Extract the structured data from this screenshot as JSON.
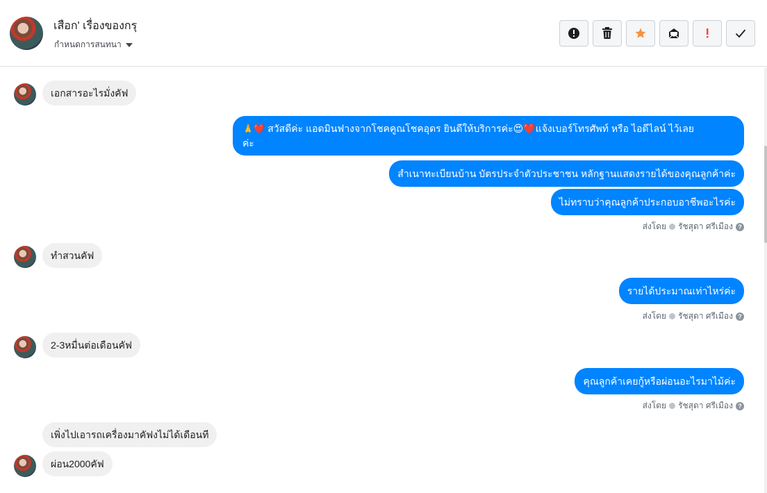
{
  "header": {
    "contact_name": "เสือก' เรื่องของกรุ",
    "assign_label": "กำหนดการสนทนา",
    "actions": [
      {
        "name": "spam",
        "icon": "exclamation-circle-icon"
      },
      {
        "name": "delete",
        "icon": "trash-icon"
      },
      {
        "name": "star",
        "icon": "star-icon",
        "color": "#f7923b"
      },
      {
        "name": "mark-unread",
        "icon": "envelope-icon"
      },
      {
        "name": "important",
        "icon": "exclamation-icon",
        "color": "#fa3e3e"
      },
      {
        "name": "done",
        "icon": "check-icon"
      }
    ]
  },
  "messages": {
    "m1": "เอกสารอะไรมั่งคัฟ",
    "m2_icons": "🙏❤️",
    "m2_line1": "สวัสดีค่ะ แอดมินฟางจากโชคคูณโชคอุดร ยินดีให้บริการค่ะ😍❤️แจ้งเบอร์โทรศัพท์ หรือ ไอดีไลน์  ไว้เลย",
    "m2_line2": "ค่ะ",
    "m3": "สำเนาทะเบียนบ้าน บัตรประจำตัวประชาชน หลักฐานแสดงรายได้ของคุณลูกค้าค่ะ",
    "m4": "ไม่ทราบว่าคุณลูกค้าประกอบอาชีพอะไรค่ะ",
    "m5": "ทำสวนคัฟ",
    "m6": "รายได้ประมาณเท่าไหร่ค่ะ",
    "m7": "2-3หมื่นต่อเดือนคัฟ",
    "m8": "คุณลูกค้าเคยกู้หรือผ่อนอะไรมาไม้ค่ะ",
    "m9": "เพิ่งไปเอารถเครื่องมาคัฟงไม่ได้เดือนที",
    "m10": "ผ่อน2000คัฟ"
  },
  "sent_by": {
    "prefix": "ส่งโดย",
    "agent": "รัชสุดา ศรีเมือง"
  },
  "colors": {
    "outgoing_bubble": "#0084ff",
    "incoming_bubble": "#f1f0f0"
  }
}
